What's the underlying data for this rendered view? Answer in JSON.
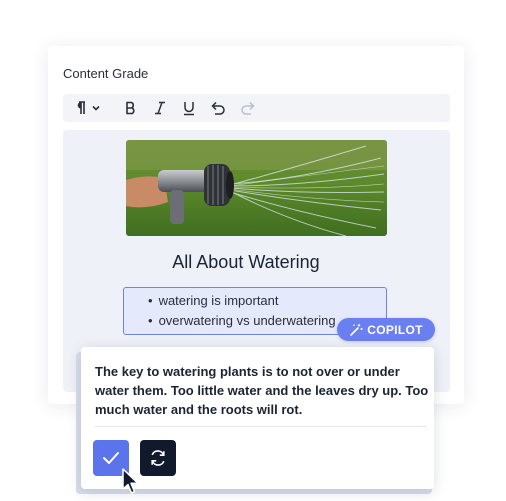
{
  "card": {
    "title": "Content Grade"
  },
  "toolbar": {
    "items": [
      "paragraph-format",
      "bold",
      "italic",
      "underline",
      "undo",
      "redo"
    ]
  },
  "document": {
    "heading": "All About Watering",
    "bullets": [
      "watering is important",
      "overwatering vs underwatering"
    ]
  },
  "copilot": {
    "badge_label": "COPILOT",
    "suggestion": "The key to watering plants is to not over or under water them. Too little water and the leaves dry up. Too much water and the roots will rot."
  },
  "colors": {
    "accent": "#5b74ec",
    "badge": "#6a7ff0",
    "dark_button": "#101a2c",
    "selection_bg": "#e4e9fb"
  }
}
